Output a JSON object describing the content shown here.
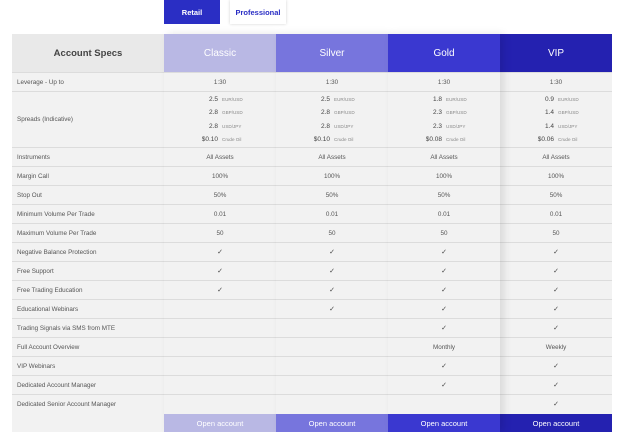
{
  "tabs": [
    {
      "label": "Retail",
      "active": true
    },
    {
      "label": "Professional",
      "active": false
    }
  ],
  "header_label": "Account Specs",
  "row_labels": [
    "Leverage - Up to",
    "Spreads (Indicative)",
    "Instruments",
    "Margin Call",
    "Stop Out",
    "Minimum Volume Per Trade",
    "Maximum Volume Per Trade",
    "Negative Balance Protection",
    "Free Support",
    "Free Trading Education",
    "Educational Webinars",
    "Trading Signals via SMS from MTE",
    "Full Account Overview",
    "VIP Webinars",
    "Dedicated Account Manager",
    "Dedicated Senior Account Manager"
  ],
  "spread_pairs": [
    "EUR/USD",
    "GBP/USD",
    "USD/JPY",
    "Crude Oil"
  ],
  "plans": [
    {
      "name": "Classic",
      "header_color": "#b9b8e4",
      "footer_color": "#b9b8e4",
      "footer_text_color": "#ffffff",
      "leverage": "1:30",
      "spreads": [
        "2.5",
        "2.8",
        "2.8",
        "$0.10"
      ],
      "instruments": "All Assets",
      "margin_call": "100%",
      "stop_out": "50%",
      "min_volume": "0.01",
      "max_volume": "50",
      "features": [
        "✓",
        "✓",
        "✓",
        "",
        "",
        "",
        "",
        "",
        ""
      ],
      "open_label": "Open account"
    },
    {
      "name": "Silver",
      "header_color": "#7775dd",
      "footer_color": "#7775dd",
      "footer_text_color": "#ffffff",
      "leverage": "1:30",
      "spreads": [
        "2.5",
        "2.8",
        "2.8",
        "$0.10"
      ],
      "instruments": "All Assets",
      "margin_call": "100%",
      "stop_out": "50%",
      "min_volume": "0.01",
      "max_volume": "50",
      "features": [
        "✓",
        "✓",
        "✓",
        "✓",
        "",
        "",
        "",
        "",
        ""
      ],
      "open_label": "Open account"
    },
    {
      "name": "Gold",
      "header_color": "#3a38d0",
      "footer_color": "#3a38d0",
      "footer_text_color": "#ffffff",
      "leverage": "1:30",
      "spreads": [
        "1.8",
        "2.3",
        "2.3",
        "$0.08"
      ],
      "instruments": "All Assets",
      "margin_call": "100%",
      "stop_out": "50%",
      "min_volume": "0.01",
      "max_volume": "50",
      "features": [
        "✓",
        "✓",
        "✓",
        "✓",
        "✓",
        "Monthly",
        "✓",
        "✓",
        ""
      ],
      "open_label": "Open account"
    },
    {
      "name": "VIP",
      "header_color": "#2421b0",
      "footer_color": "#2421b0",
      "footer_text_color": "#ffffff",
      "leverage": "1:30",
      "spreads": [
        "0.9",
        "1.4",
        "1.4",
        "$0.06"
      ],
      "instruments": "All Assets",
      "margin_call": "100%",
      "stop_out": "50%",
      "min_volume": "0.01",
      "max_volume": "50",
      "features": [
        "✓",
        "✓",
        "✓",
        "✓",
        "✓",
        "Weekly",
        "✓",
        "✓",
        "✓"
      ],
      "open_label": "Open account"
    }
  ]
}
